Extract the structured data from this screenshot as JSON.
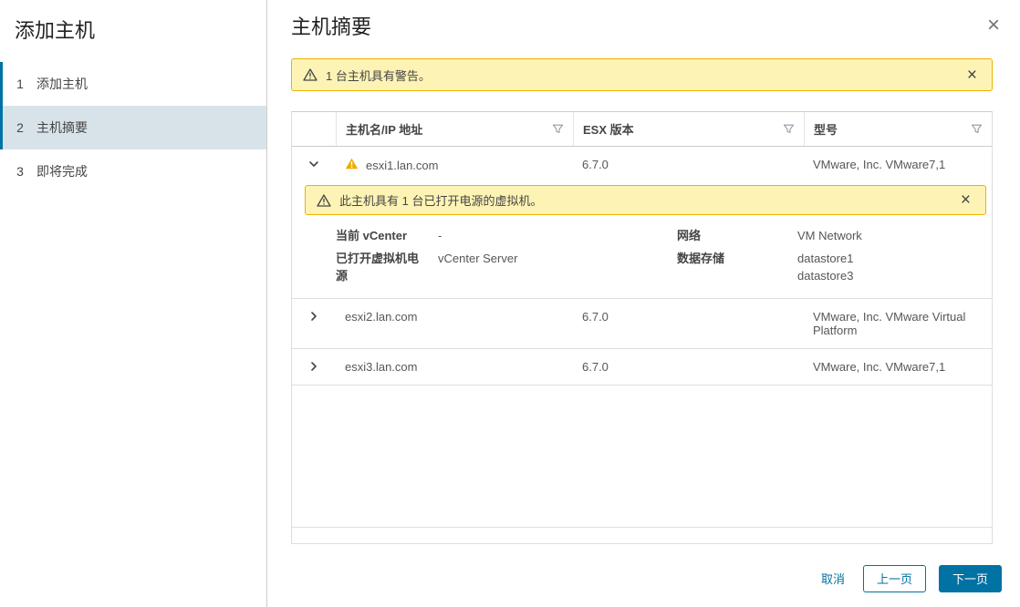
{
  "icons": {
    "close_glyph": "×"
  },
  "colors": {
    "accent": "#0072a3",
    "warning_bg": "#fdf3b5",
    "warning_border": "#edb200",
    "warning_icon": "#efab00",
    "active_step_bg": "#d8e3e9"
  },
  "sidebar": {
    "title": "添加主机",
    "steps": [
      {
        "number": "1",
        "label": "添加主机"
      },
      {
        "number": "2",
        "label": "主机摘要"
      },
      {
        "number": "3",
        "label": "即将完成"
      }
    ]
  },
  "main": {
    "title": "主机摘要",
    "warning_banner": "1 台主机具有警告。",
    "table": {
      "columns": [
        "主机名/IP 地址",
        "ESX 版本",
        "型号"
      ],
      "rows": [
        {
          "host": "esxi1.lan.com",
          "esx_version": "6.7.0",
          "model": "VMware, Inc. VMware7,1",
          "expanded": true,
          "has_warning": true,
          "warning": "此主机具有 1 台已打开电源的虚拟机。",
          "details": [
            {
              "label": "当前 vCenter",
              "value": "-"
            },
            {
              "label": "已打开虚拟机电源",
              "value": "vCenter Server"
            },
            {
              "label": "网络",
              "value": "VM Network"
            },
            {
              "label": "数据存储",
              "values": [
                "datastore1",
                "datastore3"
              ]
            }
          ]
        },
        {
          "host": "esxi2.lan.com",
          "esx_version": "6.7.0",
          "model": "VMware, Inc. VMware Virtual Platform",
          "expanded": false
        },
        {
          "host": "esxi3.lan.com",
          "esx_version": "6.7.0",
          "model": "VMware, Inc. VMware7,1",
          "expanded": false
        }
      ]
    },
    "footer": {
      "cancel": "取消",
      "previous": "上一页",
      "next": "下一页"
    }
  }
}
